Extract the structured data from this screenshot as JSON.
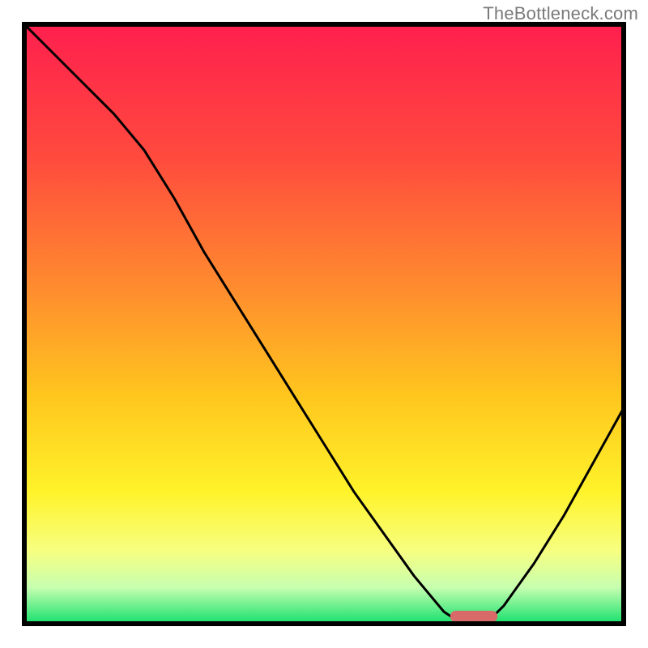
{
  "watermark": "TheBottleneck.com",
  "gradient_colors": {
    "top": "#ff1f4e",
    "upper_mid": "#ff4a3e",
    "mid": "#ff8f2e",
    "lower_mid": "#ffc61e",
    "yellow": "#fff32a",
    "pale": "#f6ff82",
    "green_pale": "#c6ffb0",
    "green": "#15e06d"
  },
  "marker_color": "#d86a6a",
  "chart_data": {
    "type": "line",
    "title": "",
    "xlabel": "",
    "ylabel": "",
    "xlim": [
      0,
      100
    ],
    "ylim": [
      0,
      100
    ],
    "x": [
      0,
      5,
      10,
      15,
      20,
      25,
      30,
      35,
      40,
      45,
      50,
      55,
      60,
      65,
      70,
      73,
      77,
      80,
      85,
      90,
      95,
      100
    ],
    "values": [
      100,
      95,
      90,
      85,
      79,
      71,
      62,
      54,
      46,
      38,
      30,
      22,
      15,
      8,
      2,
      0,
      0,
      3,
      10,
      18,
      27,
      36
    ],
    "optimal_x_range": [
      72,
      78
    ],
    "optimal_y": 0
  }
}
